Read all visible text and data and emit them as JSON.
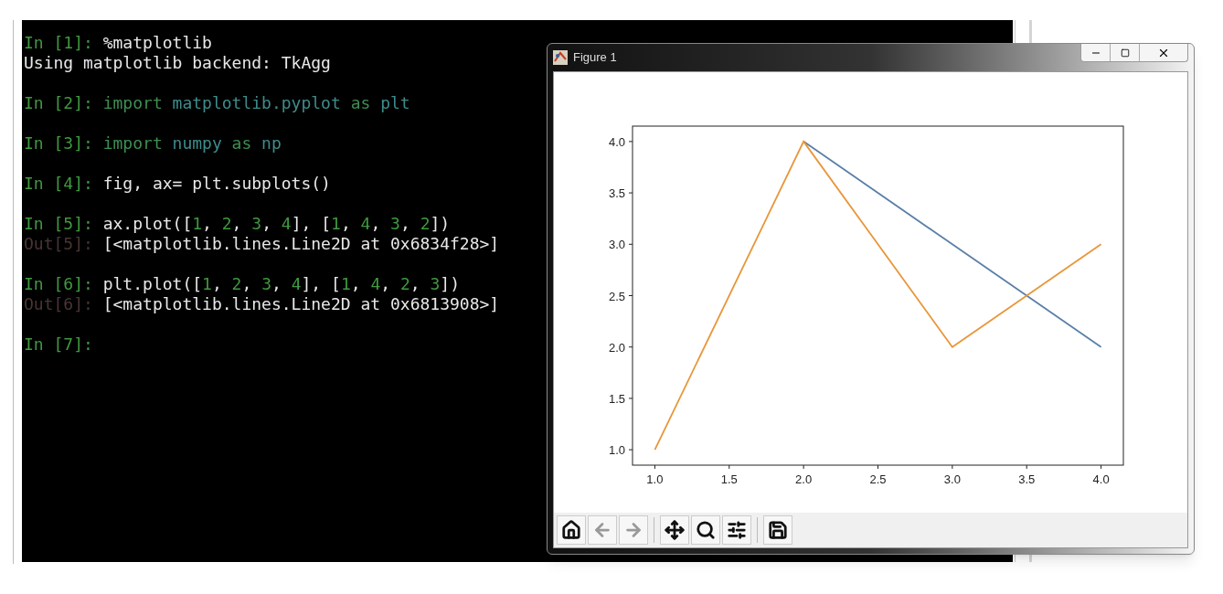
{
  "console": {
    "cells": [
      {
        "lines": [
          [
            {
              "kind": "prompt",
              "text": "In [1]:"
            },
            {
              "kind": "plain",
              "text": " %matplotlib"
            }
          ],
          [
            {
              "kind": "plain",
              "text": "Using matplotlib backend: TkAgg"
            }
          ]
        ]
      },
      {
        "lines": [
          [
            {
              "kind": "prompt",
              "text": "In [2]:"
            },
            {
              "kind": "keyword",
              "text": " import"
            },
            {
              "kind": "name",
              "text": " matplotlib.pyplot"
            },
            {
              "kind": "keyword",
              "text": " as"
            },
            {
              "kind": "name",
              "text": " plt"
            }
          ]
        ]
      },
      {
        "lines": [
          [
            {
              "kind": "prompt",
              "text": "In [3]:"
            },
            {
              "kind": "keyword",
              "text": " import"
            },
            {
              "kind": "name",
              "text": " numpy"
            },
            {
              "kind": "keyword",
              "text": " as"
            },
            {
              "kind": "name",
              "text": " np"
            }
          ]
        ]
      },
      {
        "lines": [
          [
            {
              "kind": "prompt",
              "text": "In [4]:"
            },
            {
              "kind": "plain",
              "text": " fig, ax= plt.subplots()"
            }
          ]
        ]
      },
      {
        "lines": [
          [
            {
              "kind": "prompt",
              "text": "In [5]:"
            },
            {
              "kind": "plain",
              "text": " ax.plot(["
            },
            {
              "kind": "number",
              "text": "1"
            },
            {
              "kind": "plain",
              "text": ", "
            },
            {
              "kind": "number",
              "text": "2"
            },
            {
              "kind": "plain",
              "text": ", "
            },
            {
              "kind": "number",
              "text": "3"
            },
            {
              "kind": "plain",
              "text": ", "
            },
            {
              "kind": "number",
              "text": "4"
            },
            {
              "kind": "plain",
              "text": "], ["
            },
            {
              "kind": "number",
              "text": "1"
            },
            {
              "kind": "plain",
              "text": ", "
            },
            {
              "kind": "number",
              "text": "4"
            },
            {
              "kind": "plain",
              "text": ", "
            },
            {
              "kind": "number",
              "text": "3"
            },
            {
              "kind": "plain",
              "text": ", "
            },
            {
              "kind": "number",
              "text": "2"
            },
            {
              "kind": "plain",
              "text": "])"
            }
          ],
          [
            {
              "kind": "out_prompt",
              "text": "Out[5]:"
            },
            {
              "kind": "plain",
              "text": " [<matplotlib.lines.Line2D at 0x6834f28>]"
            }
          ]
        ]
      },
      {
        "lines": [
          [
            {
              "kind": "prompt",
              "text": "In [6]:"
            },
            {
              "kind": "plain",
              "text": " plt.plot(["
            },
            {
              "kind": "number",
              "text": "1"
            },
            {
              "kind": "plain",
              "text": ", "
            },
            {
              "kind": "number",
              "text": "2"
            },
            {
              "kind": "plain",
              "text": ", "
            },
            {
              "kind": "number",
              "text": "3"
            },
            {
              "kind": "plain",
              "text": ", "
            },
            {
              "kind": "number",
              "text": "4"
            },
            {
              "kind": "plain",
              "text": "], ["
            },
            {
              "kind": "number",
              "text": "1"
            },
            {
              "kind": "plain",
              "text": ", "
            },
            {
              "kind": "number",
              "text": "4"
            },
            {
              "kind": "plain",
              "text": ", "
            },
            {
              "kind": "number",
              "text": "2"
            },
            {
              "kind": "plain",
              "text": ", "
            },
            {
              "kind": "number",
              "text": "3"
            },
            {
              "kind": "plain",
              "text": "])"
            }
          ],
          [
            {
              "kind": "out_prompt",
              "text": "Out[6]:"
            },
            {
              "kind": "plain",
              "text": " [<matplotlib.lines.Line2D at 0x6813908>]"
            }
          ]
        ]
      },
      {
        "lines": [
          [
            {
              "kind": "prompt",
              "text": "In [7]:"
            }
          ]
        ]
      }
    ]
  },
  "figure_window": {
    "title": "Figure 1",
    "chart_data": {
      "type": "line",
      "x": [
        1,
        2,
        3,
        4
      ],
      "series": [
        {
          "color": "#5a7fa8",
          "values": [
            null,
            4,
            3,
            2
          ]
        },
        {
          "color": "#e8963a",
          "values": [
            1,
            4,
            2,
            3
          ]
        }
      ],
      "xlim": [
        0.85,
        4.15
      ],
      "ylim": [
        0.85,
        4.15
      ],
      "xticks": [
        {
          "value": 1,
          "label": "1.0"
        },
        {
          "value": 1.5,
          "label": "1.5"
        },
        {
          "value": 2,
          "label": "2.0"
        },
        {
          "value": 2.5,
          "label": "2.5"
        },
        {
          "value": 3,
          "label": "3.0"
        },
        {
          "value": 3.5,
          "label": "3.5"
        },
        {
          "value": 4,
          "label": "4.0"
        }
      ],
      "yticks": [
        {
          "value": 1,
          "label": "1.0"
        },
        {
          "value": 1.5,
          "label": "1.5"
        },
        {
          "value": 2,
          "label": "2.0"
        },
        {
          "value": 2.5,
          "label": "2.5"
        },
        {
          "value": 3,
          "label": "3.0"
        },
        {
          "value": 3.5,
          "label": "3.5"
        },
        {
          "value": 4,
          "label": "4.0"
        }
      ]
    },
    "toolbar": [
      {
        "kind": "home",
        "disabled": false
      },
      {
        "kind": "back",
        "disabled": true
      },
      {
        "kind": "forward",
        "disabled": true
      },
      {
        "kind": "separator"
      },
      {
        "kind": "pan",
        "disabled": false
      },
      {
        "kind": "zoom",
        "disabled": false
      },
      {
        "kind": "configure",
        "disabled": false
      },
      {
        "kind": "separator"
      },
      {
        "kind": "save",
        "disabled": false
      }
    ]
  }
}
